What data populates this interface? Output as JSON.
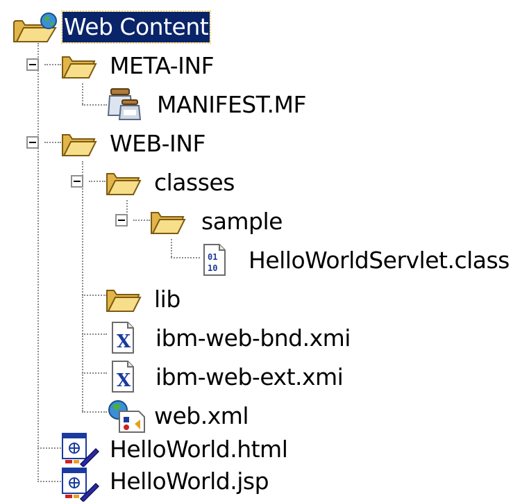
{
  "tree": {
    "root": {
      "label": "Web Content",
      "icon": "web-folder-icon",
      "selected": true
    },
    "meta_inf": {
      "label": "META-INF",
      "icon": "folder-open-icon"
    },
    "manifest": {
      "label": "MANIFEST.MF",
      "icon": "jar-file-icon"
    },
    "web_inf": {
      "label": "WEB-INF",
      "icon": "folder-open-icon"
    },
    "classes": {
      "label": "classes",
      "icon": "folder-open-icon"
    },
    "sample": {
      "label": "sample",
      "icon": "folder-open-icon"
    },
    "servlet_class": {
      "label": "HelloWorldServlet.class",
      "icon": "class-file-icon"
    },
    "lib": {
      "label": "lib",
      "icon": "folder-open-icon"
    },
    "web_bnd": {
      "label": "ibm-web-bnd.xmi",
      "icon": "xmi-file-icon"
    },
    "web_ext": {
      "label": "ibm-web-ext.xmi",
      "icon": "xmi-file-icon"
    },
    "web_xml": {
      "label": "web.xml",
      "icon": "deployment-descriptor-icon"
    },
    "hello_html": {
      "label": "HelloWorld.html",
      "icon": "html-file-icon"
    },
    "hello_jsp": {
      "label": "HelloWorld.jsp",
      "icon": "jsp-file-icon"
    }
  },
  "colors": {
    "selection_bg": "#0a246a",
    "folder_yellow": "#f6d77a",
    "tree_lines": "#8a8a8a"
  }
}
